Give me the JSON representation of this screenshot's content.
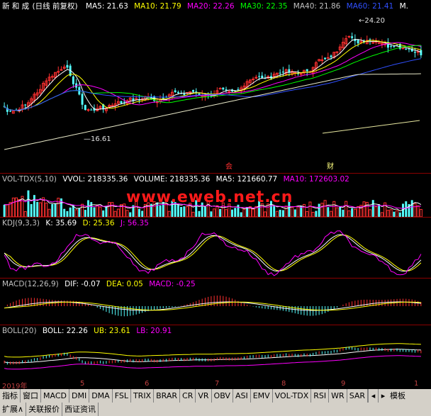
{
  "main": {
    "stock_name": "新 和 成",
    "mode": "(日线 前复权)",
    "ma": [
      {
        "label": "MA5: 21.63",
        "color": "#ffffff"
      },
      {
        "label": "MA10: 21.79",
        "color": "#ffff00"
      },
      {
        "label": "MA20: 22.26",
        "color": "#ff00ff"
      },
      {
        "label": "MA30: 22.35",
        "color": "#00ff00"
      },
      {
        "label": "MA40: 21.86",
        "color": "#c0c0c0"
      },
      {
        "label": "MA60: 21.41",
        "color": "#3050ff"
      },
      {
        "label": "M.",
        "color": "#ffffff"
      }
    ],
    "high_label": "24.20",
    "low_label": "16.61",
    "markers": [
      "会",
      "财"
    ]
  },
  "vol": {
    "title": "VOL-TDX(5,10)",
    "vvol": "VVOL: 218335.36",
    "volume": "VOLUME: 218335.36",
    "ma5": "MA5: 121660.77",
    "ma10": "MA10: 172603.02"
  },
  "kdj": {
    "title": "KDJ(9,3,3)",
    "k": "K: 35.69",
    "d": "D: 25.36",
    "j": "J: 56.35"
  },
  "macd": {
    "title": "MACD(12,26,9)",
    "dif": "DIF: -0.07",
    "dea": "DEA: 0.05",
    "macd": "MACD: -0.25"
  },
  "boll": {
    "title": "BOLL(20)",
    "boll": "BOLL: 22.26",
    "ub": "UB: 23.61",
    "lb": "LB: 20.91"
  },
  "watermark": "www.eweb.net.cn",
  "date_axis": [
    "2019年",
    "5",
    "6",
    "7",
    "8",
    "9",
    "1"
  ],
  "toolbar": {
    "tabs": [
      "指标",
      "窗口",
      "MACD",
      "DMI",
      "DMA",
      "FSL",
      "TRIX",
      "BRAR",
      "CR",
      "VR",
      "OBV",
      "ASI",
      "EMV",
      "VOL-TDX",
      "RSI",
      "WR",
      "SAR"
    ],
    "right_label": "模板"
  },
  "toolbar2": {
    "tabs": [
      "扩展∧",
      "关联报价",
      "西证资讯"
    ]
  },
  "colors": {
    "up": "#ff3030",
    "down": "#54ffff",
    "separator": "#8b0000"
  }
}
